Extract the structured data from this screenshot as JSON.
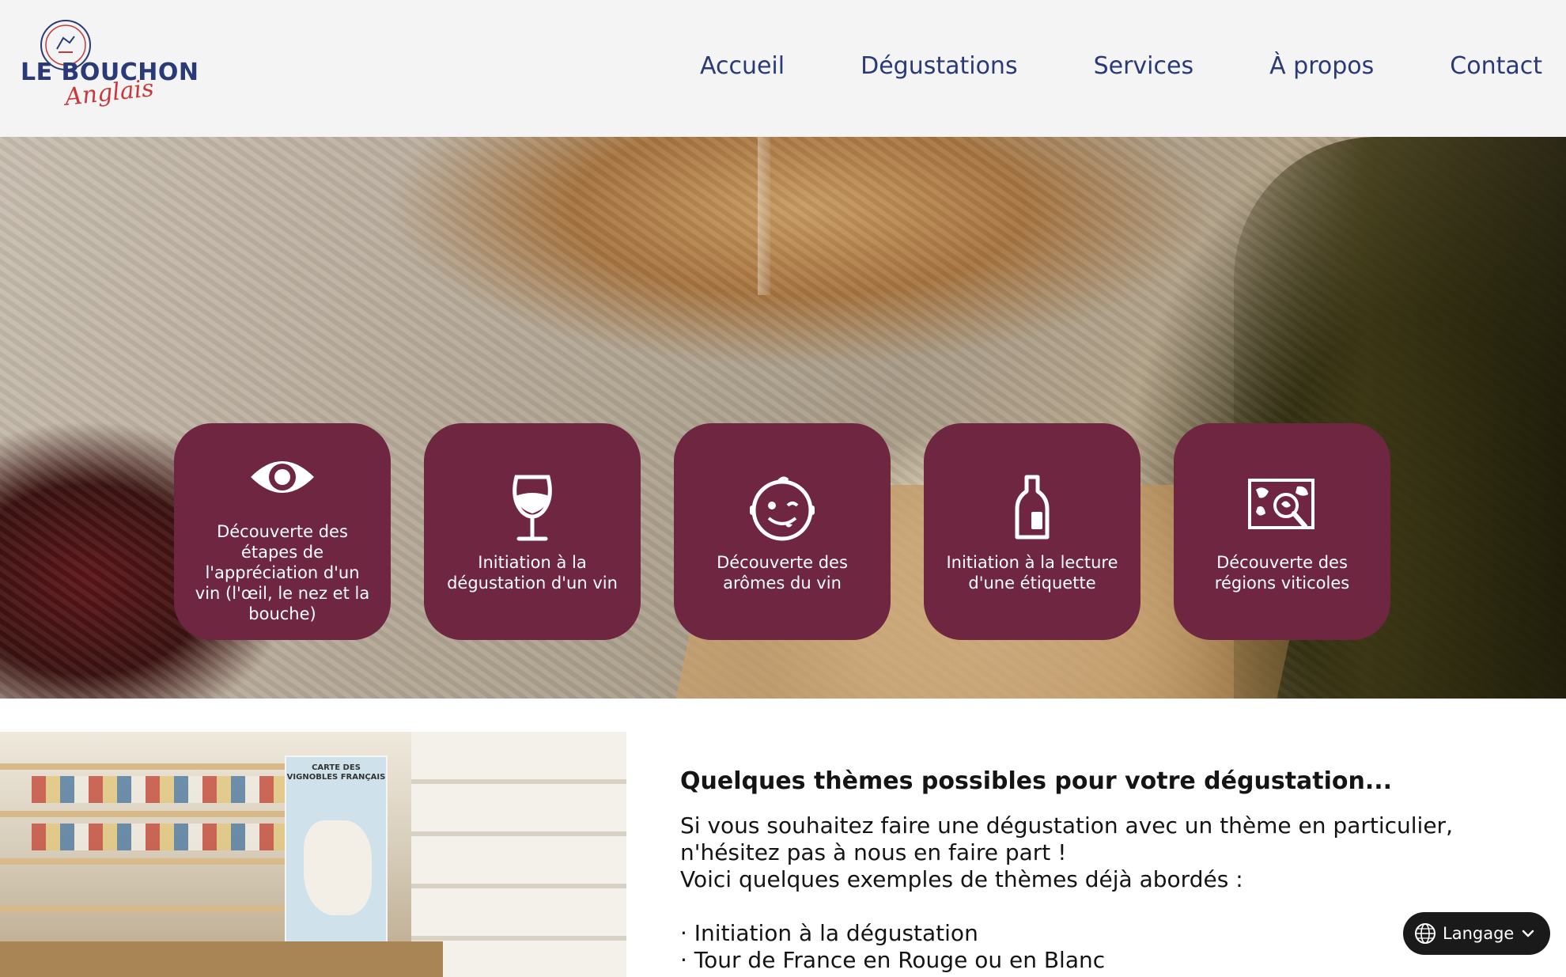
{
  "header": {
    "logo": {
      "main": "LE BOUCHON",
      "script": "Anglais"
    },
    "nav": [
      "Accueil",
      "Dégustations",
      "Services",
      "À propos",
      "Contact"
    ]
  },
  "hero": {
    "cards": [
      {
        "icon": "eye-icon",
        "text": "Découverte des étapes de l'appréciation d'un vin (l'œil, le nez et la bouche)"
      },
      {
        "icon": "wine-glass-icon",
        "text": "Initiation à la dégustation d'un vin"
      },
      {
        "icon": "winking-face-icon",
        "text": "Découverte des arômes du vin"
      },
      {
        "icon": "bottle-label-icon",
        "text": "Initiation à la lecture d'une étiquette"
      },
      {
        "icon": "map-search-icon",
        "text": "Découverte des régions viticoles"
      }
    ]
  },
  "photo": {
    "poster_title": "CARTE DES VIGNOBLES FRANÇAIS"
  },
  "content": {
    "title": "Quelques thèmes possibles pour votre dégustation...",
    "lines": [
      "Si vous souhaitez faire une dégustation avec un thème en particulier,",
      "n'hésitez pas à nous en faire part !",
      "Voici quelques exemples de thèmes déjà abordés :"
    ],
    "list": [
      "· Initiation à la dégustation",
      "· Tour de France en Rouge ou en Blanc"
    ]
  },
  "language": {
    "label": "Langage",
    "icon": "globe-icon",
    "chevron": "chevron-down-icon"
  },
  "colors": {
    "nav": "#2a3a78",
    "card": "#6e2641",
    "logo_red": "#c8393c"
  }
}
